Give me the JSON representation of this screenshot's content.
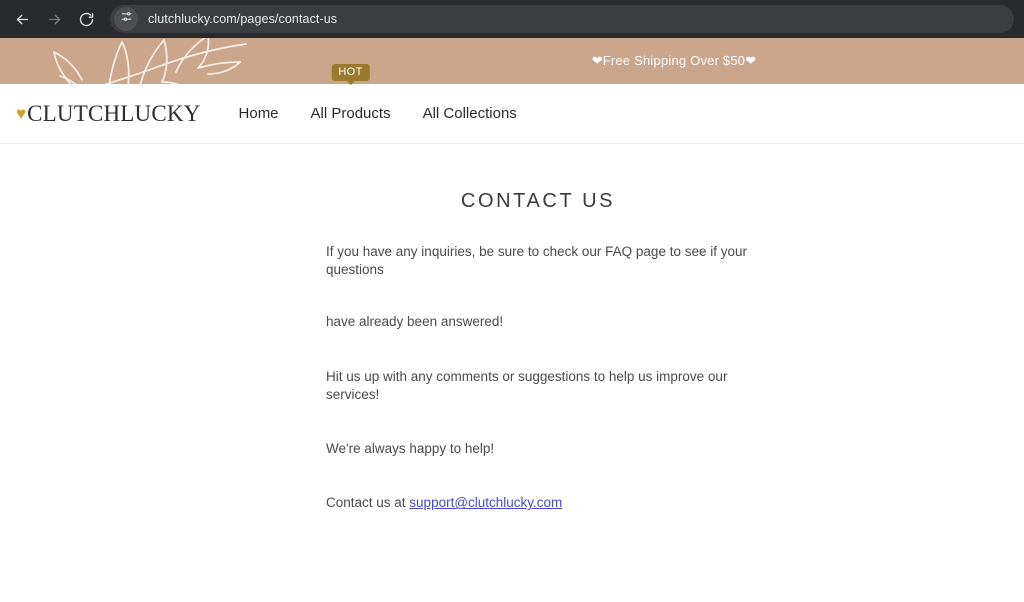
{
  "browser": {
    "back_icon": "back-arrow-icon",
    "forward_icon": "forward-arrow-icon",
    "reload_icon": "reload-icon",
    "site_settings_icon": "tune-sliders-icon",
    "url": "clutchlucky.com/pages/contact-us",
    "url_placeholder": "Search Google or type a URL"
  },
  "announcement": {
    "text": "❤Free Shipping Over $50❤",
    "background_color": "#c9a68c",
    "text_color": "#ffffff",
    "decoration": "botanical-leaf-illustration"
  },
  "header": {
    "logo": {
      "heart_icon": "heart-icon",
      "heart_color": "#c9a227",
      "text": "CLUTCHLUCKY"
    },
    "nav": [
      {
        "label": "Home",
        "badge": null
      },
      {
        "label": "All Products",
        "badge": "HOT"
      },
      {
        "label": "All Collections",
        "badge": null
      }
    ],
    "badge_color": "#9a7b2e"
  },
  "main": {
    "title": "CONTACT US",
    "paragraphs": [
      "If you have any inquiries, be sure to check our FAQ page to see if your questions",
      "have already been answered!",
      "Hit us up with any comments or suggestions to help us improve our services!",
      "We're always happy to help!"
    ],
    "contact_prefix": "Contact us at ",
    "contact_email": "support@clutchlucky.com",
    "link_color": "#4b49c9"
  }
}
